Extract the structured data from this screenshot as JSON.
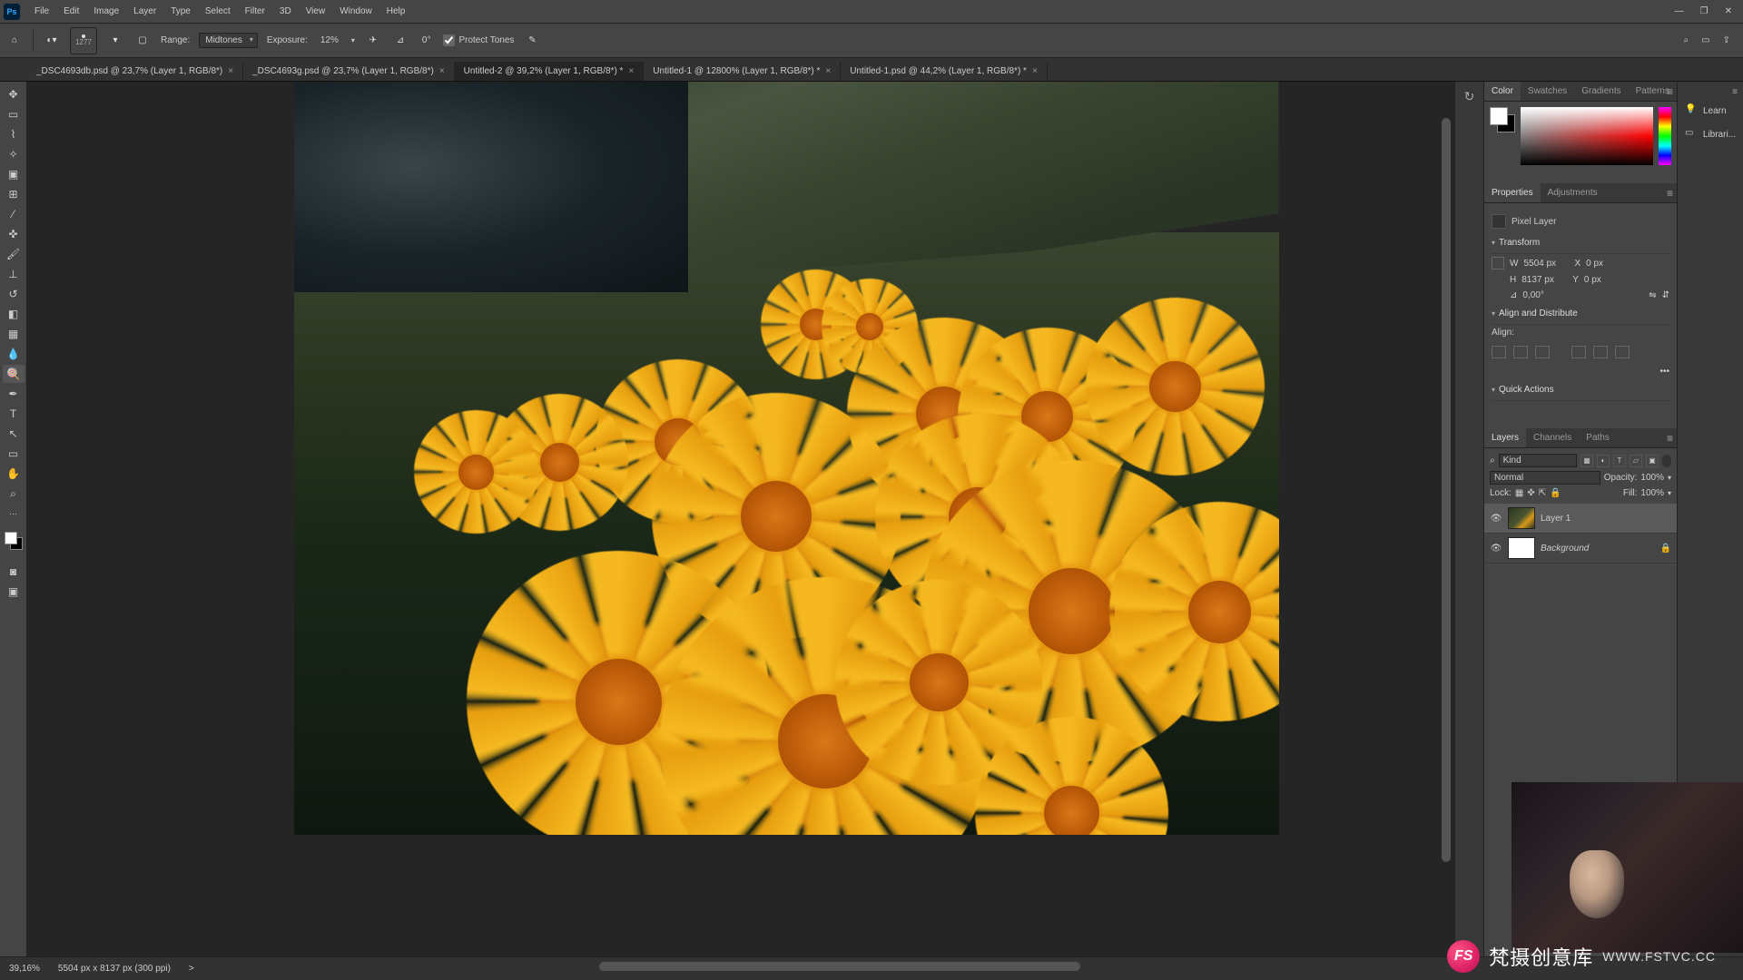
{
  "menu": {
    "items": [
      "File",
      "Edit",
      "Image",
      "Layer",
      "Type",
      "Select",
      "Filter",
      "3D",
      "View",
      "Window",
      "Help"
    ],
    "logo": "Ps"
  },
  "win": {
    "min": "—",
    "max": "❐",
    "close": "✕"
  },
  "options": {
    "range_label": "Range:",
    "range_value": "Midtones",
    "exposure_label": "Exposure:",
    "exposure_value": "12%",
    "rotate": "0°",
    "protect": "Protect Tones",
    "brush_size": "1277"
  },
  "tabs": [
    {
      "label": "_DSC4693db.psd @ 23,7% (Layer 1, RGB/8*)",
      "active": false
    },
    {
      "label": "_DSC4693g.psd @ 23,7% (Layer 1, RGB/8*)",
      "active": false
    },
    {
      "label": "Untitled-2 @ 39,2% (Layer 1, RGB/8*) *",
      "active": true
    },
    {
      "label": "Untitled-1 @ 12800% (Layer 1, RGB/8*) *",
      "active": false
    },
    {
      "label": "Untitled-1.psd @ 44,2% (Layer 1, RGB/8*) *",
      "active": false
    }
  ],
  "rpanel": {
    "learn": "Learn",
    "libraries": "Librari..."
  },
  "color": {
    "tabs": [
      "Color",
      "Swatches",
      "Gradients",
      "Patterns"
    ]
  },
  "props": {
    "tabs": [
      "Properties",
      "Adjustments"
    ],
    "type": "Pixel Layer",
    "transform": "Transform",
    "w_label": "W",
    "w": "5504 px",
    "x_label": "X",
    "x": "0 px",
    "h_label": "H",
    "h": "8137 px",
    "y_label": "Y",
    "y": "0 px",
    "angle": "0,00°",
    "align_section": "Align and Distribute",
    "align_label": "Align:",
    "quick": "Quick Actions",
    "more": "•••"
  },
  "layers": {
    "tabs": [
      "Layers",
      "Channels",
      "Paths"
    ],
    "kind": "Kind",
    "normal": "Normal",
    "opacity_label": "Opacity:",
    "opacity": "100%",
    "lock_label": "Lock:",
    "fill_label": "Fill:",
    "fill": "100%",
    "items": [
      {
        "name": "Layer 1",
        "bg": false,
        "sel": true
      },
      {
        "name": "Background",
        "bg": true,
        "sel": false
      }
    ]
  },
  "status": {
    "zoom": "39,16%",
    "dims": "5504 px x 8137 px (300 ppi)",
    "arrow": ">"
  },
  "watermark": {
    "brand": "梵摄创意库",
    "url": "WWW.FSTVC.CC",
    "logo": "FS"
  },
  "flowers": [
    {
      "t": 27,
      "l": 49,
      "s": 8
    },
    {
      "t": 28,
      "l": 55,
      "s": 7
    },
    {
      "t": 35,
      "l": 59,
      "s": 14
    },
    {
      "t": 36,
      "l": 70,
      "s": 13
    },
    {
      "t": 32,
      "l": 83,
      "s": 13
    },
    {
      "t": 40,
      "l": 33,
      "s": 12
    },
    {
      "t": 44,
      "l": 22,
      "s": 10
    },
    {
      "t": 46,
      "l": 14,
      "s": 9
    },
    {
      "t": 46,
      "l": 40,
      "s": 18
    },
    {
      "t": 48,
      "l": 62,
      "s": 15
    },
    {
      "t": 56,
      "l": 68,
      "s": 22
    },
    {
      "t": 60,
      "l": 86,
      "s": 16
    },
    {
      "t": 68,
      "l": 22,
      "s": 22
    },
    {
      "t": 72,
      "l": 42,
      "s": 24
    },
    {
      "t": 70,
      "l": 58,
      "s": 15
    },
    {
      "t": 88,
      "l": 72,
      "s": 14
    }
  ]
}
